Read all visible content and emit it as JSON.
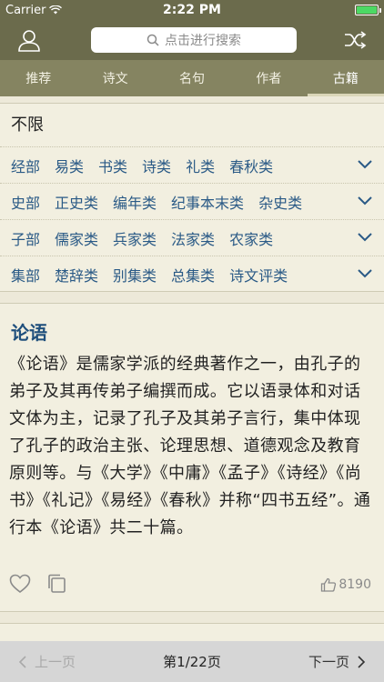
{
  "status": {
    "carrier": "Carrier",
    "time": "2:22 PM"
  },
  "nav": {
    "search_placeholder": "点击进行搜索"
  },
  "tabs": [
    {
      "label": "推荐"
    },
    {
      "label": "诗文"
    },
    {
      "label": "名句"
    },
    {
      "label": "作者"
    },
    {
      "label": "古籍"
    }
  ],
  "filter": {
    "all_label": "不限",
    "rows": [
      {
        "items": [
          "经部",
          "易类",
          "书类",
          "诗类",
          "礼类",
          "春秋类"
        ]
      },
      {
        "items": [
          "史部",
          "正史类",
          "编年类",
          "纪事本末类",
          "杂史类"
        ]
      },
      {
        "items": [
          "子部",
          "儒家类",
          "兵家类",
          "法家类",
          "农家类"
        ]
      },
      {
        "items": [
          "集部",
          "楚辞类",
          "别集类",
          "总集类",
          "诗文评类"
        ]
      }
    ]
  },
  "card": {
    "title": "论语",
    "body": "《论语》是儒家学派的经典著作之一，由孔子的弟子及其再传弟子编撰而成。它以语录体和对话文体为主，记录了孔子及其弟子言行，集中体现了孔子的政治主张、论理思想、道德观念及教育原则等。与《大学》《中庸》《孟子》《诗经》《尚书》《礼记》《易经》《春秋》并称“四书五经”。通行本《论语》共二十篇。",
    "likes": "8190"
  },
  "pager": {
    "prev": "上一页",
    "page": "第1/22页",
    "next": "下一页"
  }
}
